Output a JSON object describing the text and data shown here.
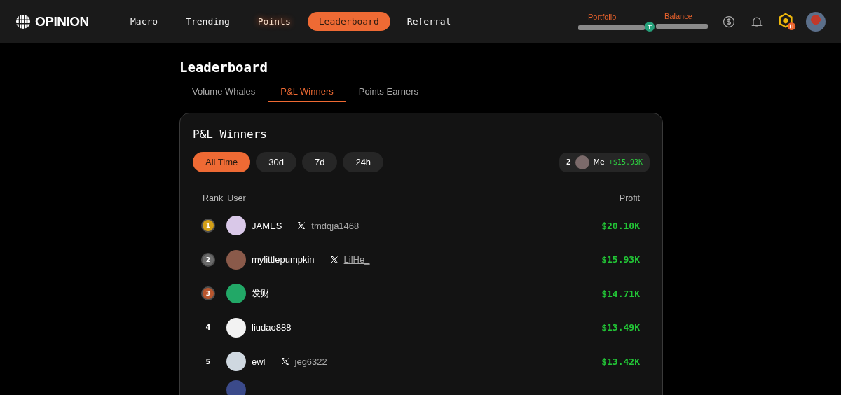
{
  "brand": {
    "name": "OPINION"
  },
  "nav": [
    {
      "label": "Macro",
      "selected": false,
      "glow": false
    },
    {
      "label": "Trending",
      "selected": false,
      "glow": false
    },
    {
      "label": "Points",
      "selected": false,
      "glow": true
    },
    {
      "label": "Leaderboard",
      "selected": true,
      "glow": false
    },
    {
      "label": "Referral",
      "selected": false,
      "glow": false
    }
  ],
  "account": {
    "portfolio_label": "Portfolio",
    "balance_label": "Balance"
  },
  "page_title": "Leaderboard",
  "tabs": [
    {
      "label": "Volume Whales",
      "selected": false
    },
    {
      "label": "P&L Winners",
      "selected": true
    },
    {
      "label": "Points Earners",
      "selected": false
    }
  ],
  "card": {
    "title": "P&L Winners",
    "filters": [
      {
        "label": "All Time",
        "selected": true
      },
      {
        "label": "30d",
        "selected": false
      },
      {
        "label": "7d",
        "selected": false
      },
      {
        "label": "24h",
        "selected": false
      }
    ],
    "me": {
      "rank": "2",
      "name": "Me",
      "profit": "+$15.93K"
    },
    "columns": [
      "Rank",
      "User",
      "Profit"
    ],
    "rows": [
      {
        "rank": "1",
        "kind": "medal",
        "color": "#d4a017",
        "avatar": {
          "color": "#d9c8e8"
        },
        "user": "JAMES",
        "x_handle": "tmdqja1468",
        "profit": "$20.10K"
      },
      {
        "rank": "2",
        "kind": "medal",
        "color": "#6b6b6b",
        "avatar": {
          "color": "#8a5a4a"
        },
        "user": "mylittlepumpkin",
        "x_handle": "LilHe_",
        "profit": "$15.93K"
      },
      {
        "rank": "3",
        "kind": "medal",
        "color": "#b8562e",
        "avatar": {
          "color": "#22a867"
        },
        "user": "发财",
        "profit": "$14.71K"
      },
      {
        "rank": "4",
        "kind": "plain",
        "avatar": {
          "color": "#f2f2f2"
        },
        "user": "liudao888",
        "profit": "$13.49K"
      },
      {
        "rank": "5",
        "kind": "plain",
        "avatar": {
          "color": "#cfd8e0"
        },
        "user": "ewl",
        "x_handle": "jeg6322",
        "profit": "$13.42K"
      }
    ]
  }
}
